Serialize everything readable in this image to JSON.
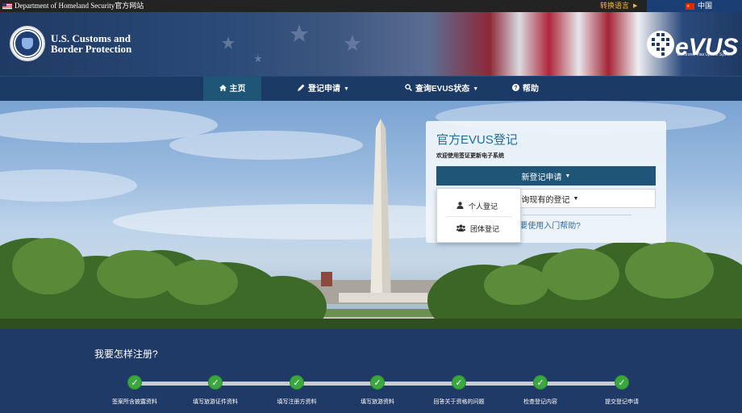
{
  "topbar": {
    "gov_text": "Department of Homeland Security官方网站",
    "switch_language": "转换语言",
    "language": "中国"
  },
  "header": {
    "agency_line1": "U.S. Customs and",
    "agency_line2": "Border Protection",
    "evus_logo_text": "eVUS",
    "evus_subtitle": "Electronic Visa Update System"
  },
  "nav": {
    "items": [
      {
        "label": "主页",
        "icon": "home-icon"
      },
      {
        "label": "登记申请",
        "icon": "pencil-icon"
      },
      {
        "label": "查询EVUS状态",
        "icon": "search-icon"
      },
      {
        "label": "帮助",
        "icon": "question-icon"
      }
    ]
  },
  "panel": {
    "title": "官方EVUS登记",
    "subtitle": "欢迎使用签证更新电子系统",
    "new_button": "新登记申请",
    "check_button": "查询现有的登记",
    "help_link": "需要使用入门帮助?"
  },
  "dropdown": {
    "items": [
      {
        "label": "个人登记",
        "icon": "user-icon"
      },
      {
        "label": "团体登记",
        "icon": "users-icon"
      }
    ]
  },
  "steps": {
    "title": "我要怎样注册?",
    "items": [
      "签案所含披露资料",
      "填写旅游证件资料",
      "填写注册方资料",
      "填写旅游资料",
      "回答关于资格的问题",
      "检查登记内容",
      "提交登记申请"
    ]
  },
  "colors": {
    "nav_bg": "#1c3a66",
    "accent": "#1f5577",
    "step_green": "#3aa83e",
    "lang_gold": "#f2b632",
    "link_blue": "#2f6fa7"
  }
}
